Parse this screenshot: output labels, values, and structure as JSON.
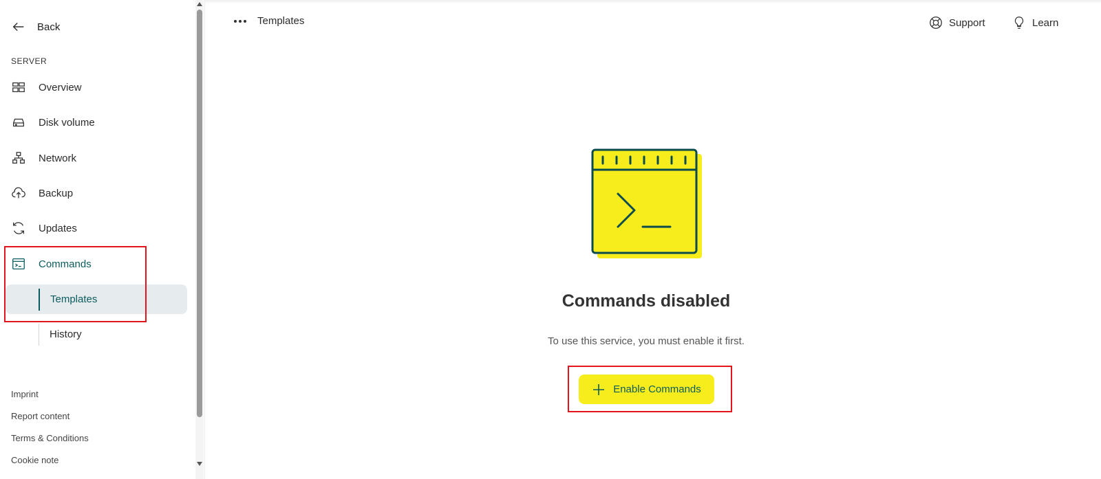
{
  "sidebar": {
    "back_label": "Back",
    "section_title": "SERVER",
    "items": [
      {
        "label": "Overview",
        "icon": "overview-icon"
      },
      {
        "label": "Disk volume",
        "icon": "disk-icon"
      },
      {
        "label": "Network",
        "icon": "network-icon"
      },
      {
        "label": "Backup",
        "icon": "cloud-upload-icon"
      },
      {
        "label": "Updates",
        "icon": "refresh-icon"
      },
      {
        "label": "Commands",
        "icon": "terminal-icon",
        "active": true
      }
    ],
    "sub_items": [
      {
        "label": "Templates",
        "active": true
      },
      {
        "label": "History"
      }
    ],
    "footer": [
      "Imprint",
      "Report content",
      "Terms & Conditions",
      "Cookie note"
    ]
  },
  "topbar": {
    "breadcrumb": "Templates",
    "support_label": "Support",
    "learn_label": "Learn"
  },
  "main": {
    "empty_title": "Commands disabled",
    "empty_text": "To use this service, you must enable it first.",
    "enable_button_label": "Enable Commands"
  },
  "colors": {
    "accent": "#0b5b5e",
    "highlight": "#f7ed1c",
    "active_bg": "#e6eced",
    "annotation": "#e3141b"
  }
}
